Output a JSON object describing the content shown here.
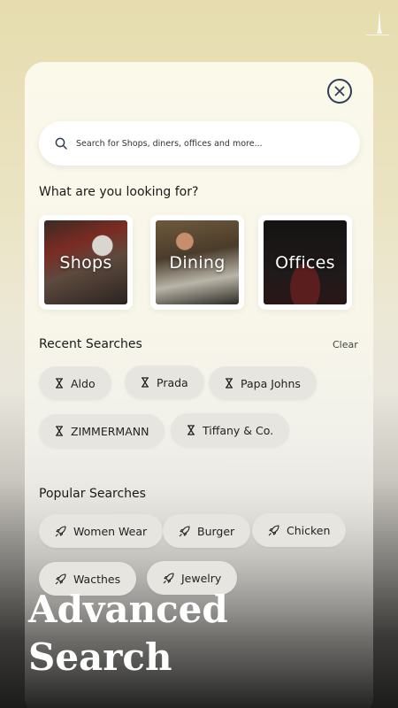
{
  "logo": {
    "icon": "tower-logo-icon",
    "brand_text": ""
  },
  "header": {
    "close_icon": "close-icon"
  },
  "search": {
    "placeholder": "Search for Shops, diners, offices and more...",
    "icon": "search-icon"
  },
  "categories_section": {
    "title": "What are you looking for?",
    "items": [
      {
        "label": "Shops"
      },
      {
        "label": "Dining"
      },
      {
        "label": "Offices"
      }
    ]
  },
  "recent": {
    "title": "Recent Searches",
    "clear_label": "Clear",
    "icon": "hourglass-icon",
    "items": [
      {
        "label": "Aldo"
      },
      {
        "label": "Prada"
      },
      {
        "label": "Papa Johns"
      },
      {
        "label": "ZIMMERMANN"
      },
      {
        "label": "Tiffany & Co."
      }
    ]
  },
  "popular": {
    "title": "Popular Searches",
    "icon": "rocket-icon",
    "items": [
      {
        "label": "Women Wear"
      },
      {
        "label": "Burger"
      },
      {
        "label": "Chicken"
      },
      {
        "label": "Wacthes"
      },
      {
        "label": "Jewelry"
      }
    ]
  },
  "promo": {
    "line1": "Advanced",
    "line2": "Search"
  },
  "colors": {
    "close_ring": "#2d3f55",
    "chip_bg": "#e6e5e0",
    "background_top": "#e6dcae",
    "background_bottom": "#1c1c1b"
  }
}
